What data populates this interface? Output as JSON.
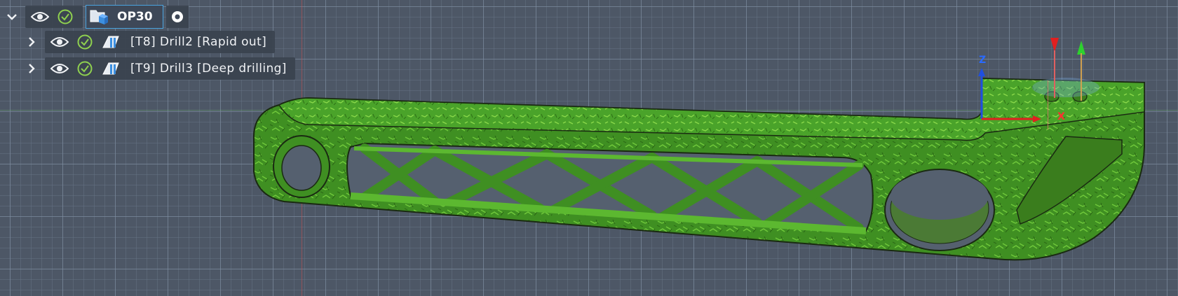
{
  "tree": {
    "setup": {
      "label": "OP30",
      "icon": "setup-folder-icon"
    },
    "operations": [
      {
        "label": "[T8] Drill2 [Rapid out]",
        "icon": "drill-operation-icon"
      },
      {
        "label": "[T9] Drill3 [Deep drilling]",
        "icon": "drill-operation-icon"
      }
    ]
  },
  "triad": {
    "z_label": "Z",
    "x_label": "X"
  },
  "colors": {
    "part_green": "#3f8f22",
    "part_green_light": "#5cb830",
    "axis_red": "#e02020",
    "axis_green": "#2ed12e",
    "axis_blue": "#1f4fe0",
    "selection_blue": "#4aa3df",
    "viewport_bg": "#4d5766"
  }
}
